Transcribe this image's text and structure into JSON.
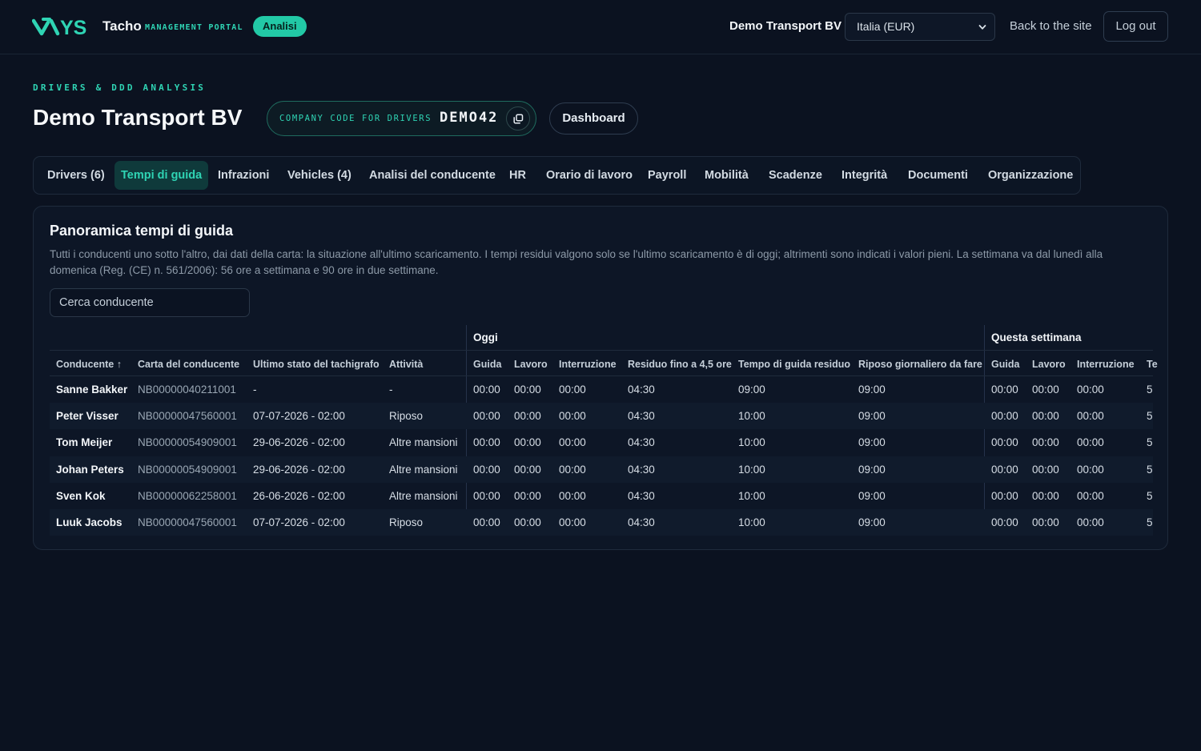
{
  "topbar": {
    "brand": "Tacho",
    "brand_sub": "MANAGEMENT PORTAL",
    "badge": "Analisi",
    "company": "Demo Transport BV",
    "region_select": "Italia (EUR)",
    "back_link": "Back to the site",
    "logout": "Log out"
  },
  "header": {
    "eyebrow": "DRIVERS & DDD ANALYSIS",
    "title": "Demo Transport BV",
    "code_label": "COMPANY CODE FOR DRIVERS",
    "code_value": "DEMO42",
    "dashboard_button": "Dashboard"
  },
  "tabs": [
    {
      "label": "Drivers (6)"
    },
    {
      "label": "Tempi di guida"
    },
    {
      "label": "Infrazioni"
    },
    {
      "label": "Vehicles (4)"
    },
    {
      "label": "Analisi del conducente"
    },
    {
      "label": "HR"
    },
    {
      "label": "Orario di lavoro"
    },
    {
      "label": "Payroll"
    },
    {
      "label": "Mobilità"
    },
    {
      "label": "Scadenze"
    },
    {
      "label": "Integrità"
    },
    {
      "label": "Documenti"
    },
    {
      "label": "Organizzazione"
    }
  ],
  "active_tab": "Tempi di guida",
  "panel": {
    "title": "Panoramica tempi di guida",
    "description": "Tutti i conducenti uno sotto l'altro, dai dati della carta: la situazione all'ultimo scaricamento. I tempi residui valgono solo se l'ultimo scaricamento è di oggi; altrimenti sono indicati i valori pieni. La settimana va dal lunedì alla domenica (Reg. (CE) n. 561/2006): 56 ore a settimana e 90 ore in due settimane.",
    "search_placeholder": "Cerca conducente"
  },
  "table": {
    "group_today": "Oggi",
    "group_week": "Questa settimana",
    "columns": [
      "Conducente ↑",
      "Carta del conducente",
      "Ultimo stato del tachigrafo",
      "Attività",
      "Guida",
      "Lavoro",
      "Interruzione",
      "Residuo fino a 4,5 ore",
      "Tempo di guida residuo",
      "Riposo giornaliero da fare",
      "Guida",
      "Lavoro",
      "Interruzione",
      "Te"
    ],
    "rows": [
      [
        "Sanne Bakker",
        "NB00000040211001",
        "-",
        "-",
        "00:00",
        "00:00",
        "00:00",
        "04:30",
        "09:00",
        "09:00",
        "00:00",
        "00:00",
        "00:00",
        "5"
      ],
      [
        "Peter Visser",
        "NB00000047560001",
        "07-07-2026 - 02:00",
        "Riposo",
        "00:00",
        "00:00",
        "00:00",
        "04:30",
        "10:00",
        "09:00",
        "00:00",
        "00:00",
        "00:00",
        "5"
      ],
      [
        "Tom Meijer",
        "NB00000054909001",
        "29-06-2026 - 02:00",
        "Altre mansioni",
        "00:00",
        "00:00",
        "00:00",
        "04:30",
        "10:00",
        "09:00",
        "00:00",
        "00:00",
        "00:00",
        "5"
      ],
      [
        "Johan Peters",
        "NB00000054909001",
        "29-06-2026 - 02:00",
        "Altre mansioni",
        "00:00",
        "00:00",
        "00:00",
        "04:30",
        "10:00",
        "09:00",
        "00:00",
        "00:00",
        "00:00",
        "5"
      ],
      [
        "Sven Kok",
        "NB00000062258001",
        "26-06-2026 - 02:00",
        "Altre mansioni",
        "00:00",
        "00:00",
        "00:00",
        "04:30",
        "10:00",
        "09:00",
        "00:00",
        "00:00",
        "00:00",
        "5"
      ],
      [
        "Luuk Jacobs",
        "NB00000047560001",
        "07-07-2026 - 02:00",
        "Riposo",
        "00:00",
        "00:00",
        "00:00",
        "04:30",
        "10:00",
        "09:00",
        "00:00",
        "00:00",
        "00:00",
        "5"
      ]
    ]
  },
  "colors": {
    "accent": "#2fd4b4",
    "background": "#0b1220",
    "panel": "#0d1626"
  }
}
